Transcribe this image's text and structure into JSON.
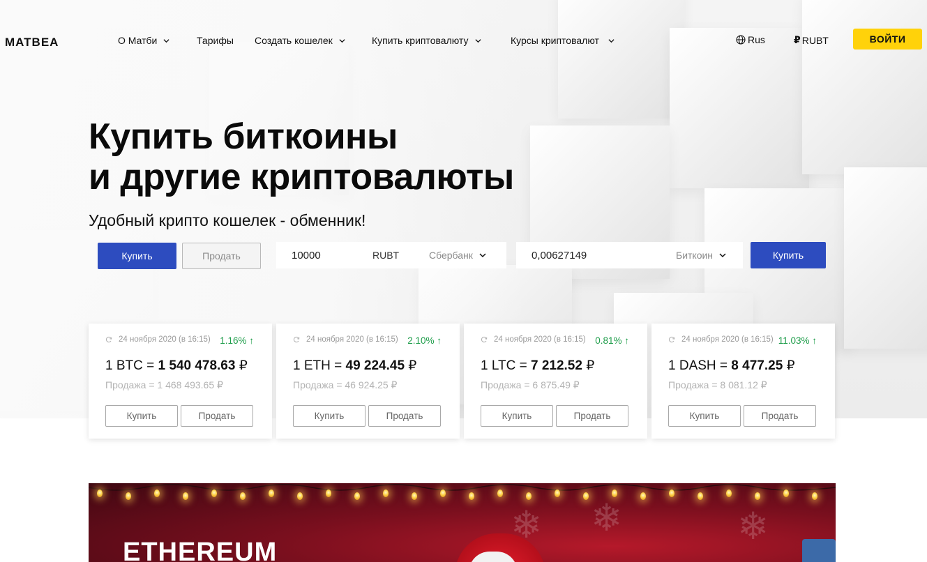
{
  "brand": {
    "logo": "MATBEA"
  },
  "nav": {
    "items": [
      {
        "label": "О Матби",
        "has_dropdown": true
      },
      {
        "label": "Тарифы",
        "has_dropdown": false
      },
      {
        "label": "Создать кошелек",
        "has_dropdown": true
      },
      {
        "label": "Купить криптовалюту",
        "has_dropdown": true
      },
      {
        "label": "Курсы криптовалют",
        "has_dropdown": true
      }
    ],
    "language": "Rus",
    "currency_symbol": "₽",
    "currency": "RUBT",
    "login_label": "ВОЙТИ"
  },
  "hero": {
    "title_line1": "Купить биткоины",
    "title_line2": "и другие криптовалюты",
    "subtitle": "Удобный крипто кошелек - обменник!"
  },
  "exchange": {
    "tab_buy": "Купить",
    "tab_sell": "Продать",
    "amount": "10000",
    "amount_currency": "RUBT",
    "payment_method": "Сбербанк",
    "result_amount": "0,00627149",
    "result_currency": "Биткоин",
    "submit_label": "Купить"
  },
  "rates": [
    {
      "timestamp": "24 ноября 2020 (в 16:15)",
      "change": "1.16% ↑",
      "unit": "1 BTC = ",
      "price": "1 540 478.63",
      "currency": " ₽",
      "sell": "Продажа = 1 468 493.65 ₽",
      "buy_label": "Купить",
      "sell_label": "Продать"
    },
    {
      "timestamp": "24 ноября 2020 (в 16:15)",
      "change": "2.10% ↑",
      "unit": "1 ETH = ",
      "price": "49 224.45",
      "currency": " ₽",
      "sell": "Продажа = 46 924.25 ₽",
      "buy_label": "Купить",
      "sell_label": "Продать"
    },
    {
      "timestamp": "24 ноября 2020 (в 16:15)",
      "change": "0.81% ↑",
      "unit": "1 LTC = ",
      "price": "7 212.52",
      "currency": " ₽",
      "sell": "Продажа = 6 875.49 ₽",
      "buy_label": "Купить",
      "sell_label": "Продать"
    },
    {
      "timestamp": "24 ноября 2020 (в 16:15)",
      "change": "11.03% ↑",
      "unit": "1 DASH = ",
      "price": "8 477.25",
      "currency": " ₽",
      "sell": "Продажа = 8 081.12 ₽",
      "buy_label": "Купить",
      "sell_label": "Продать"
    }
  ],
  "banner": {
    "title": "ETHEREUM"
  },
  "colors": {
    "accent_blue": "#2d4cbf",
    "login_yellow": "#ffd20a",
    "positive_green": "#1e9d4a",
    "banner_red": "#7a0f1e"
  },
  "icons": {
    "nav_dropdown": "chevron-down-icon",
    "language": "globe-icon",
    "rate_refresh": "refresh-icon",
    "select_dropdown": "chevron-down-icon"
  }
}
